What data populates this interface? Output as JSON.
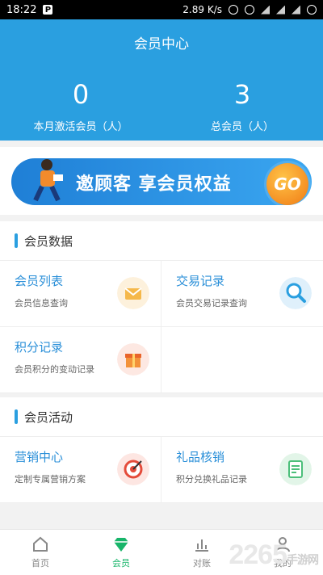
{
  "status": {
    "time": "18:22",
    "speed": "2.89 K/s"
  },
  "header": {
    "title": "会员中心"
  },
  "stats": [
    {
      "value": "0",
      "label": "本月激活会员（人）"
    },
    {
      "value": "3",
      "label": "总会员（人）"
    }
  ],
  "banner": {
    "text": "邀顾客  享会员权益",
    "go": "GO"
  },
  "member_data": {
    "title": "会员数据",
    "items": [
      {
        "title": "会员列表",
        "sub": "会员信息查询"
      },
      {
        "title": "交易记录",
        "sub": "会员交易记录查询"
      },
      {
        "title": "积分记录",
        "sub": "会员积分的变动记录"
      }
    ]
  },
  "member_activity": {
    "title": "会员活动",
    "items": [
      {
        "title": "营销中心",
        "sub": "定制专属营销方案"
      },
      {
        "title": "礼品核销",
        "sub": "积分兑换礼品记录"
      }
    ]
  },
  "tabs": [
    {
      "label": "首页"
    },
    {
      "label": "会员"
    },
    {
      "label": "对账"
    },
    {
      "label": "我的"
    }
  ],
  "watermark": "2265",
  "watermark_sub": "手游网",
  "colors": {
    "primary": "#2a9fe0",
    "active_tab": "#18b56a"
  }
}
